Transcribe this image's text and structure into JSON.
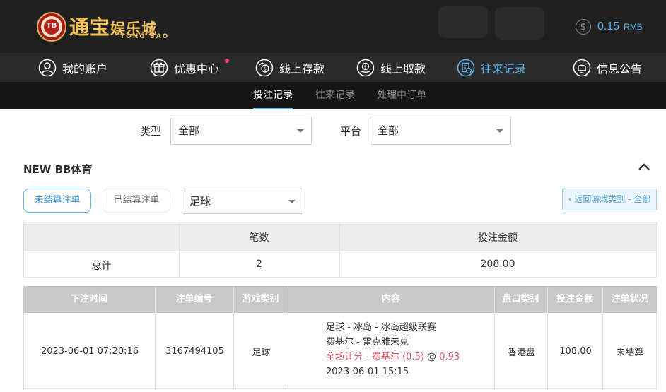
{
  "header": {
    "logo_badge": "TB",
    "logo_cn_main": "通宝",
    "logo_cn_sub": "娱乐城",
    "logo_en": "TONG BAO",
    "balance_symbol": "$",
    "balance_amount": "0.15",
    "balance_currency": "RMB"
  },
  "nav": {
    "items": [
      {
        "label": "我的账户",
        "icon": "user-icon"
      },
      {
        "label": "优惠中心",
        "icon": "gift-icon"
      },
      {
        "label": "线上存款",
        "icon": "deposit-icon"
      },
      {
        "label": "线上取款",
        "icon": "withdraw-icon"
      },
      {
        "label": "往来记录",
        "icon": "records-icon"
      },
      {
        "label": "信息公告",
        "icon": "bell-icon"
      }
    ],
    "active_index": 4,
    "accent_color": "#5fb3e8",
    "badge_color": "#e84a5f"
  },
  "subnav": {
    "items": [
      "投注记录",
      "往来记录",
      "处理中订单"
    ],
    "active_index": 0
  },
  "filters": {
    "type_label": "类型",
    "type_value": "全部",
    "platform_label": "平台",
    "platform_value": "全部"
  },
  "section": {
    "title": "NEW BB体育"
  },
  "tabs": {
    "unsettled": "未结算注单",
    "settled": "已结算注单",
    "sport_select": "足球",
    "back_label": "‹ 返回游戏类别 - 全部"
  },
  "summary": {
    "headers": [
      "",
      "笔数",
      "投注金额"
    ],
    "row": {
      "label": "总计",
      "count": "2",
      "amount": "208.00"
    }
  },
  "bets": {
    "headers": [
      "下注时间",
      "注单编号",
      "游戏类别",
      "内容",
      "盘口类别",
      "投注金额",
      "注单状况"
    ],
    "rows": [
      {
        "time": "2023-06-01 07:20:16",
        "id": "3167494105",
        "category": "足球",
        "content_line1": "足球 - 冰岛 - 冰岛超级联赛",
        "content_line2": "费基尔 - 雷克雅未克",
        "content_market": "全场让分 - 费基尔 (0.5)",
        "content_at": "@",
        "content_odds": "0.93",
        "content_date": "2023-06-01 15:15",
        "odds_type": "香港盘",
        "amount": "108.00",
        "status": "未结算"
      }
    ]
  }
}
